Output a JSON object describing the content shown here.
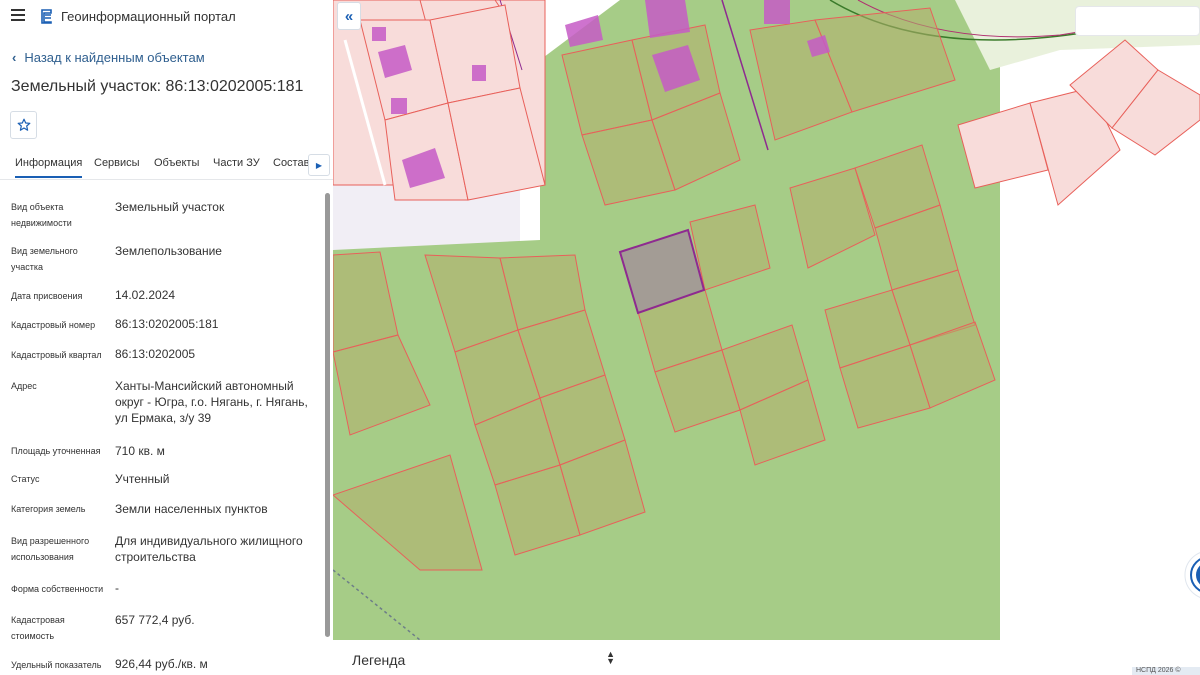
{
  "header": {
    "title": "Геоинформационный портал"
  },
  "nav": {
    "back_label": "Назад к найденным объектам"
  },
  "page": {
    "title": "Земельный участок: 86:13:0202005:181"
  },
  "tabs": [
    {
      "label": "Информация",
      "active": true
    },
    {
      "label": "Сервисы"
    },
    {
      "label": "Объекты"
    },
    {
      "label": "Части ЗУ"
    },
    {
      "label": "Состав"
    }
  ],
  "properties": [
    {
      "label": "Вид объекта недвижимости",
      "value": "Земельный участок"
    },
    {
      "label": "Вид земельного участка",
      "value": "Землепользование"
    },
    {
      "label": "Дата присвоения",
      "value": "14.02.2024"
    },
    {
      "label": "Кадастровый номер",
      "value": "86:13:0202005:181"
    },
    {
      "label": "Кадастровый квартал",
      "value": "86:13:0202005"
    },
    {
      "label": "Адрес",
      "value": "Ханты-Мансийский автономный округ - Югра, г.о. Нягань, г. Нягань, ул Ермака, з/у 39"
    },
    {
      "label": "Площадь уточненная",
      "value": "710 кв. м"
    },
    {
      "label": "Статус",
      "value": "Учтенный"
    },
    {
      "label": "Категория земель",
      "value": "Земли населенных пунктов"
    },
    {
      "label": "Вид разрешенного использования",
      "value": "Для индивидуального жилищного строительства"
    },
    {
      "label": "Форма собственности",
      "value": "-"
    },
    {
      "label": "Кадастровая стоимость",
      "value": "657 772,4 руб."
    },
    {
      "label": "Удельный показатель",
      "value": "926,44 руб./кв. м"
    }
  ],
  "map": {
    "legend_title": "Легенда",
    "copyright": "НСПД 2026 ©",
    "colors": {
      "zone_green": "#a6cc87",
      "parcel_fill": "#f8dcda",
      "parcel_line": "#e8605a",
      "building": "#c65bc6",
      "selected_outline": "#8e2a90",
      "accent": "#1a5fb4"
    }
  }
}
